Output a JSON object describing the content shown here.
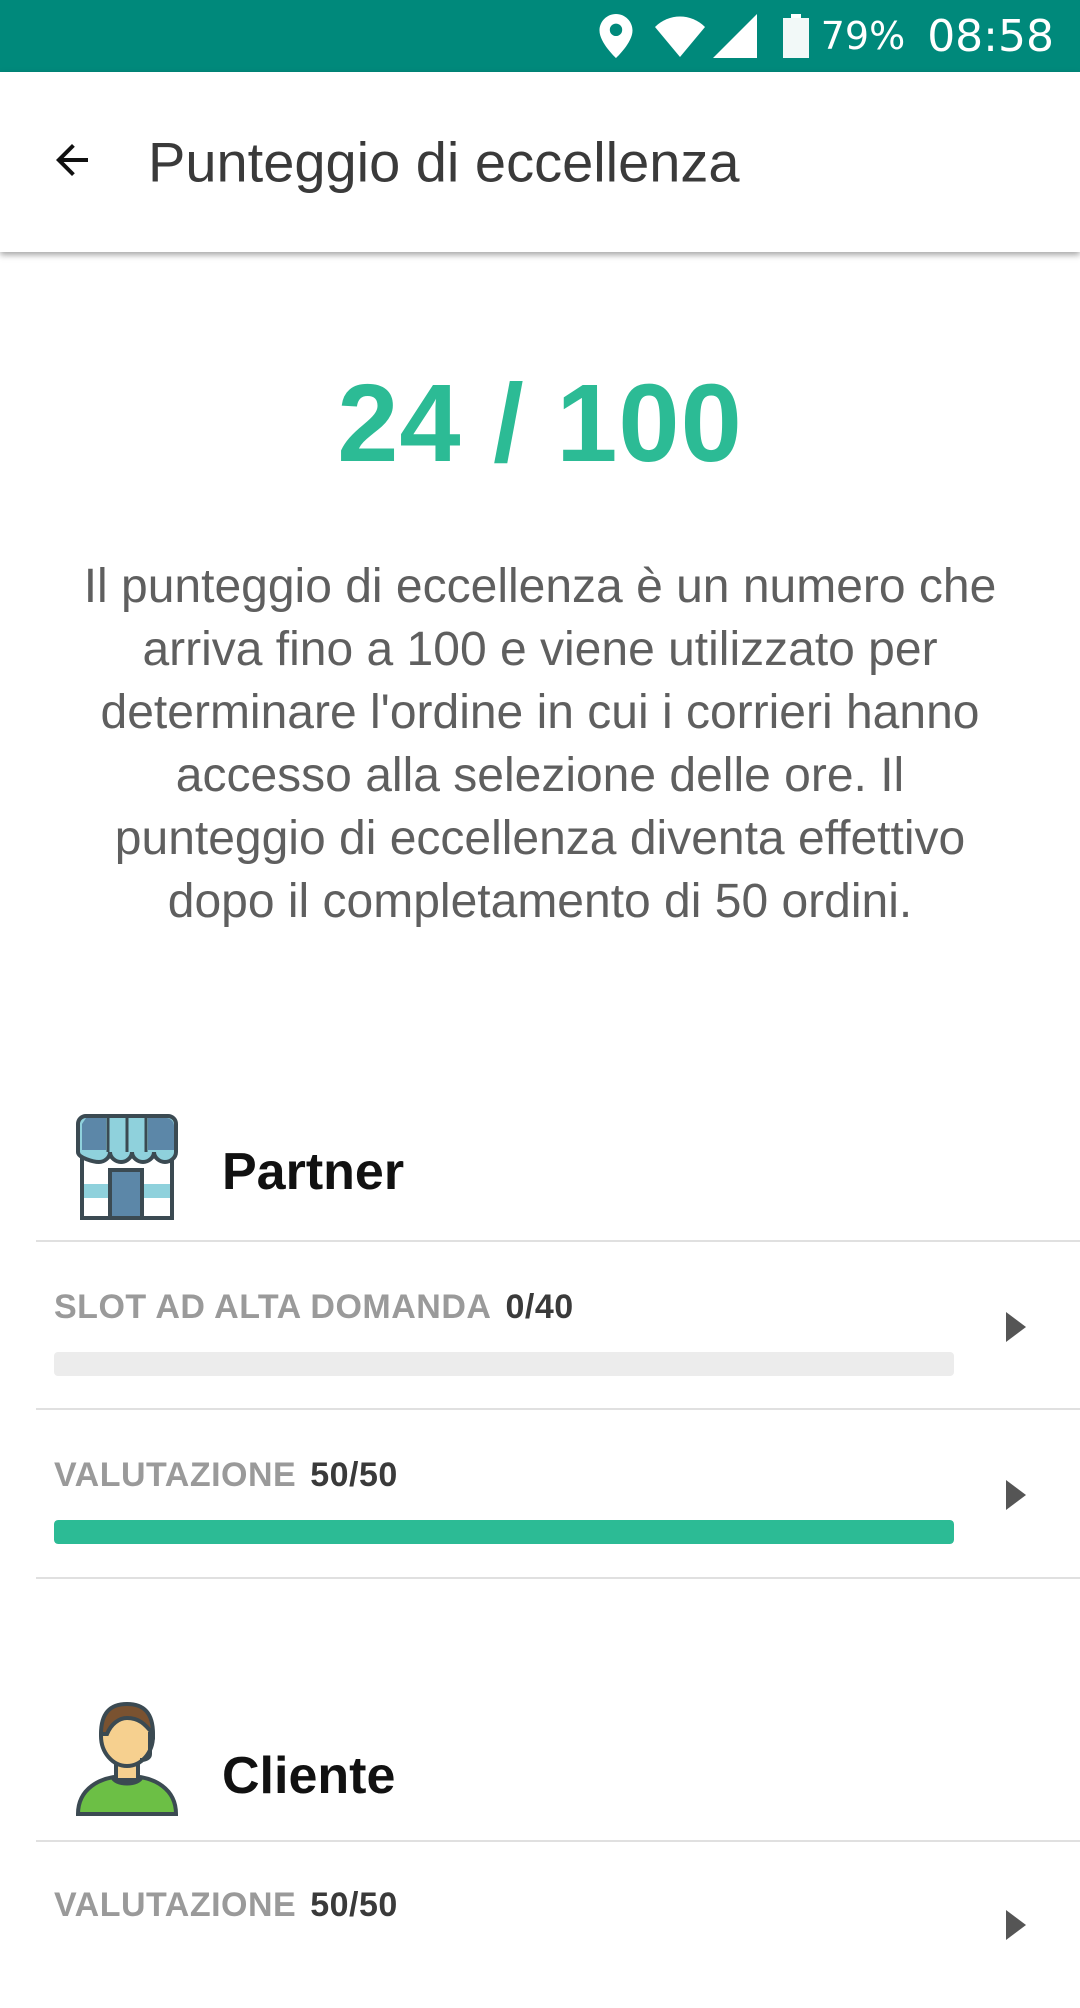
{
  "status_bar": {
    "battery_percent": "79%",
    "time": "08:58",
    "background": "#00897B"
  },
  "appbar": {
    "title": "Punteggio di eccellenza",
    "back_icon": "arrow-back-icon"
  },
  "score": {
    "text": "24 / 100",
    "value": 24,
    "max": 100,
    "color": "#2CBB95"
  },
  "description": "Il punteggio di eccellenza è un numero che arriva fino a 100 e viene utilizzato per determinare l'ordine in cui i corrieri hanno accesso alla selezione delle ore. Il punteggio di eccellenza diventa effettivo dopo il completamento di 50 ordini.",
  "sections": [
    {
      "title": "Partner",
      "icon": "storefront-icon",
      "metrics": [
        {
          "label": "SLOT AD ALTA DOMANDA",
          "value": "0/40",
          "progress": 0.0
        },
        {
          "label": "VALUTAZIONE",
          "value": "50/50",
          "progress": 1.0
        }
      ]
    },
    {
      "title": "Cliente",
      "icon": "customer-avatar-icon",
      "metrics": [
        {
          "label": "VALUTAZIONE",
          "value": "50/50"
        }
      ]
    }
  ]
}
